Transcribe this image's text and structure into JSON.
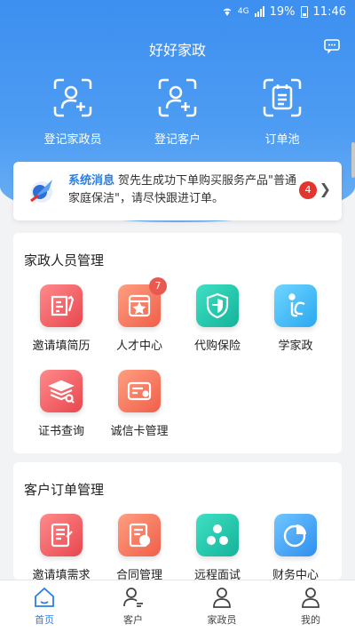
{
  "status_bar": {
    "network": "4G",
    "battery": "19%",
    "time": "11:46"
  },
  "app": {
    "title": "好好家政"
  },
  "quick_actions": [
    {
      "label": "登记家政员"
    },
    {
      "label": "登记客户"
    },
    {
      "label": "订单池"
    }
  ],
  "notice": {
    "title": "系统消息",
    "text": "贺先生成功下单购买服务产品\"普通家庭保洁\"，请尽快跟进订单。",
    "badge": "4"
  },
  "staff_section": {
    "title": "家政人员管理",
    "items": [
      {
        "label": "邀请填简历",
        "icon": "resume-icon",
        "color": "red"
      },
      {
        "label": "人才中心",
        "icon": "talent-icon",
        "color": "orange",
        "badge": "7"
      },
      {
        "label": "代购保险",
        "icon": "insurance-shield-icon",
        "color": "teal"
      },
      {
        "label": "学家政",
        "icon": "learn-icon",
        "color": "cyan"
      },
      {
        "label": "证书查询",
        "icon": "certificate-icon",
        "color": "red"
      },
      {
        "label": "诚信卡管理",
        "icon": "credit-card-icon",
        "color": "orange"
      }
    ]
  },
  "customer_section": {
    "title": "客户订单管理",
    "items": [
      {
        "label": "邀请填需求",
        "icon": "demand-form-icon",
        "color": "red"
      },
      {
        "label": "合同管理",
        "icon": "contract-icon",
        "color": "orange"
      },
      {
        "label": "远程面试",
        "icon": "remote-interview-icon",
        "color": "teal"
      },
      {
        "label": "财务中心",
        "icon": "finance-pie-icon",
        "color": "blue"
      }
    ]
  },
  "tabs": [
    {
      "label": "首页",
      "icon": "home-icon",
      "active": true
    },
    {
      "label": "客户",
      "icon": "customer-icon"
    },
    {
      "label": "家政员",
      "icon": "staff-icon"
    },
    {
      "label": "我的",
      "icon": "profile-icon"
    }
  ],
  "colors": {
    "primary": "#3d8ff0",
    "badge": "#e3352e"
  }
}
